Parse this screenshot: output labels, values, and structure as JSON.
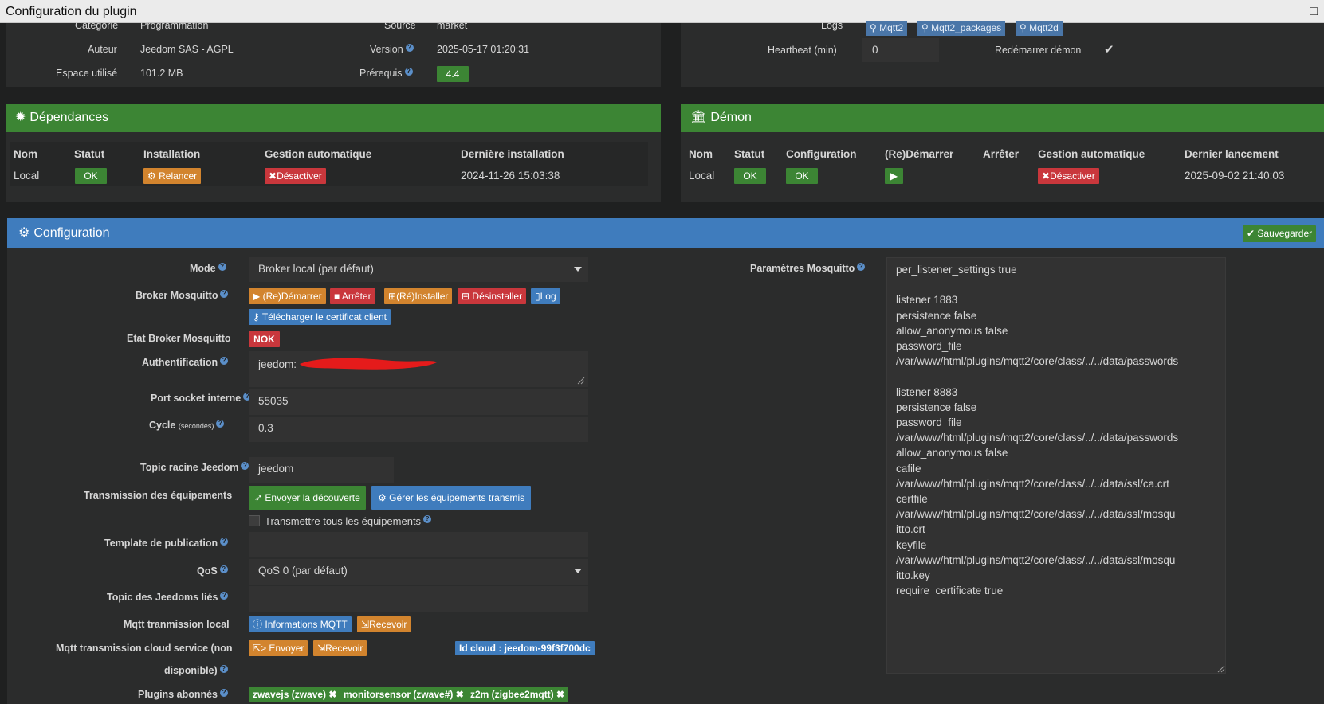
{
  "window": {
    "title": "Configuration du plugin",
    "close_glyph": "□"
  },
  "info": {
    "categorie_label": "Catégorie",
    "categorie_value": "Programmation",
    "source_label": "Source",
    "source_value": "market",
    "auteur_label": "Auteur",
    "auteur_value": "Jeedom SAS",
    "auteur_license": " - AGPL",
    "version_label": "Version",
    "version_value": "2025-05-17 01:20:31",
    "espace_label": "Espace utilisé",
    "espace_value": "101.2 MB",
    "prerequis_label": "Prérequis",
    "prerequis_value": "4.4",
    "logs_label": "Logs",
    "logs": [
      "Mqtt2",
      "Mqtt2_packages",
      "Mqtt2d"
    ],
    "heartbeat_label": "Heartbeat (min)",
    "heartbeat_value": "0",
    "redemarrer_label": "Redémarrer démon",
    "redemarrer_checked": true
  },
  "dependances": {
    "title": "Dépendances",
    "headers": [
      "Nom",
      "Statut",
      "Installation",
      "Gestion automatique",
      "Dernière installation"
    ],
    "row": {
      "nom": "Local",
      "statut": "OK",
      "installation": "Relancer",
      "gestion": "Désactiver",
      "derniere": "2024-11-26 15:03:38"
    }
  },
  "demon": {
    "title": "Démon",
    "headers": [
      "Nom",
      "Statut",
      "Configuration",
      "(Re)Démarrer",
      "Arrêter",
      "Gestion automatique",
      "Dernier lancement"
    ],
    "row": {
      "nom": "Local",
      "statut": "OK",
      "configuration": "OK",
      "gestion": "Désactiver",
      "dernier": "2025-09-02 21:40:03"
    }
  },
  "configuration": {
    "title": "Configuration",
    "save_label": "Sauvegarder",
    "mode_label": "Mode",
    "mode_value": "Broker local (par défaut)",
    "broker_label": "Broker Mosquitto",
    "broker_buttons": {
      "demarrer": "(Re)Démarrer",
      "arreter": "Arrêter",
      "installer": "(Ré)Installer",
      "desinstaller": "Désinstaller",
      "log": "Log"
    },
    "certificat_label": "Télécharger le certificat client",
    "etat_label": "Etat Broker Mosquitto",
    "etat_value": "NOK",
    "auth_label": "Authentification",
    "auth_value": "jeedom:",
    "port_label": "Port socket interne",
    "port_value": "55035",
    "cycle_label": "Cycle",
    "cycle_unit": "(secondes)",
    "cycle_value": "0.3",
    "topic_label": "Topic racine Jeedom",
    "topic_value": "jeedom",
    "transmission_label": "Transmission des équipements",
    "envoyer_decouverte": "Envoyer la découverte",
    "gerer_equipements": "Gérer les équipements transmis",
    "transmettre_tous": "Transmettre tous les équipements",
    "template_label": "Template de publication",
    "template_value": "",
    "qos_label": "QoS",
    "qos_value": "QoS 0 (par défaut)",
    "topic_lies_label": "Topic des Jeedoms liés",
    "topic_lies_value": "",
    "mqtt_local_label": "Mqtt tranmission local",
    "informations_mqtt": "Informations MQTT",
    "recevoir": "Recevoir",
    "cloud_label_1": "Mqtt transmission cloud service (non",
    "cloud_label_2": "disponible)",
    "envoyer": "> Envoyer",
    "recevoir_cloud": "Recevoir",
    "id_cloud": "Id cloud : jeedom-99f3f700dc",
    "plugins_label": "Plugins abonnés",
    "plugins": [
      "zwavejs (zwave)",
      "monitorsensor (zwave#)",
      "z2m (zigbee2mqtt)"
    ],
    "mosquitto_label": "Paramètres Mosquitto",
    "mosquitto_text": "per_listener_settings true\n\nlistener 1883\npersistence false\nallow_anonymous false\npassword_file\n/var/www/html/plugins/mqtt2/core/class/../../data/passwords\n\nlistener 8883\npersistence false\npassword_file\n/var/www/html/plugins/mqtt2/core/class/../../data/passwords\nallow_anonymous false\ncafile\n/var/www/html/plugins/mqtt2/core/class/../../data/ssl/ca.crt\ncertfile\n/var/www/html/plugins/mqtt2/core/class/../../data/ssl/mosqu\nitto.crt\nkeyfile\n/var/www/html/plugins/mqtt2/core/class/../../data/ssl/mosqu\nitto.key\nrequire_certificate true"
  },
  "colors": {
    "green": "#3c8534",
    "blue": "#3f7cbd",
    "orange": "#d2842e",
    "red": "#c9373c",
    "background": "#1f2020"
  }
}
